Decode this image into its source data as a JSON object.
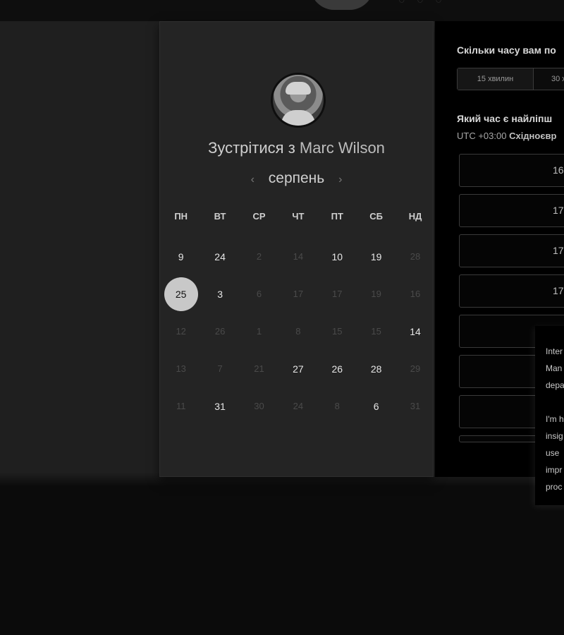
{
  "header": {
    "logo": "calendar-logo-icon"
  },
  "booking": {
    "avatar": "host-avatar",
    "title_prefix": "Зустрітися з",
    "host_name": "Marc Wilson",
    "month": "серпень",
    "prev_month": "‹",
    "next_month": "›",
    "weekdays": [
      "ПН",
      "ВТ",
      "СР",
      "ЧТ",
      "ПТ",
      "СБ",
      "НД"
    ],
    "weeks": [
      [
        {
          "d": "9",
          "s": "on"
        },
        {
          "d": "24",
          "s": "on"
        },
        {
          "d": "2",
          "s": "off"
        },
        {
          "d": "14",
          "s": "off"
        },
        {
          "d": "10",
          "s": "on"
        },
        {
          "d": "19",
          "s": "on"
        },
        {
          "d": "28",
          "s": "off"
        }
      ],
      [
        {
          "d": "25",
          "s": "sel"
        },
        {
          "d": "3",
          "s": "on"
        },
        {
          "d": "6",
          "s": "off"
        },
        {
          "d": "17",
          "s": "off"
        },
        {
          "d": "17",
          "s": "off"
        },
        {
          "d": "19",
          "s": "off"
        },
        {
          "d": "16",
          "s": "off"
        }
      ],
      [
        {
          "d": "12",
          "s": "off"
        },
        {
          "d": "26",
          "s": "off"
        },
        {
          "d": "1",
          "s": "off"
        },
        {
          "d": "8",
          "s": "off"
        },
        {
          "d": "15",
          "s": "off"
        },
        {
          "d": "15",
          "s": "off"
        },
        {
          "d": "14",
          "s": "on"
        }
      ],
      [
        {
          "d": "13",
          "s": "off"
        },
        {
          "d": "7",
          "s": "off"
        },
        {
          "d": "21",
          "s": "off"
        },
        {
          "d": "27",
          "s": "on"
        },
        {
          "d": "26",
          "s": "on"
        },
        {
          "d": "28",
          "s": "on"
        },
        {
          "d": "29",
          "s": "off"
        }
      ],
      [
        {
          "d": "11",
          "s": "off"
        },
        {
          "d": "31",
          "s": "on"
        },
        {
          "d": "30",
          "s": "off"
        },
        {
          "d": "24",
          "s": "off"
        },
        {
          "d": "8",
          "s": "off"
        },
        {
          "d": "6",
          "s": "on"
        },
        {
          "d": "31",
          "s": "off"
        }
      ]
    ]
  },
  "options": {
    "duration_question": "Скільки часу вам по",
    "durations": [
      "15 хвилин",
      "30 х"
    ],
    "time_question": "Який час є найліпш",
    "tz_offset": "UTC +03:00",
    "tz_name": "Східноєвр",
    "slots": [
      "16",
      "17",
      "17",
      "17",
      "",
      "",
      ""
    ]
  },
  "popover": {
    "lines": [
      "Inter",
      "Man",
      "depa",
      "",
      "I'm h",
      "insig",
      "use",
      "impr",
      "proc"
    ]
  }
}
